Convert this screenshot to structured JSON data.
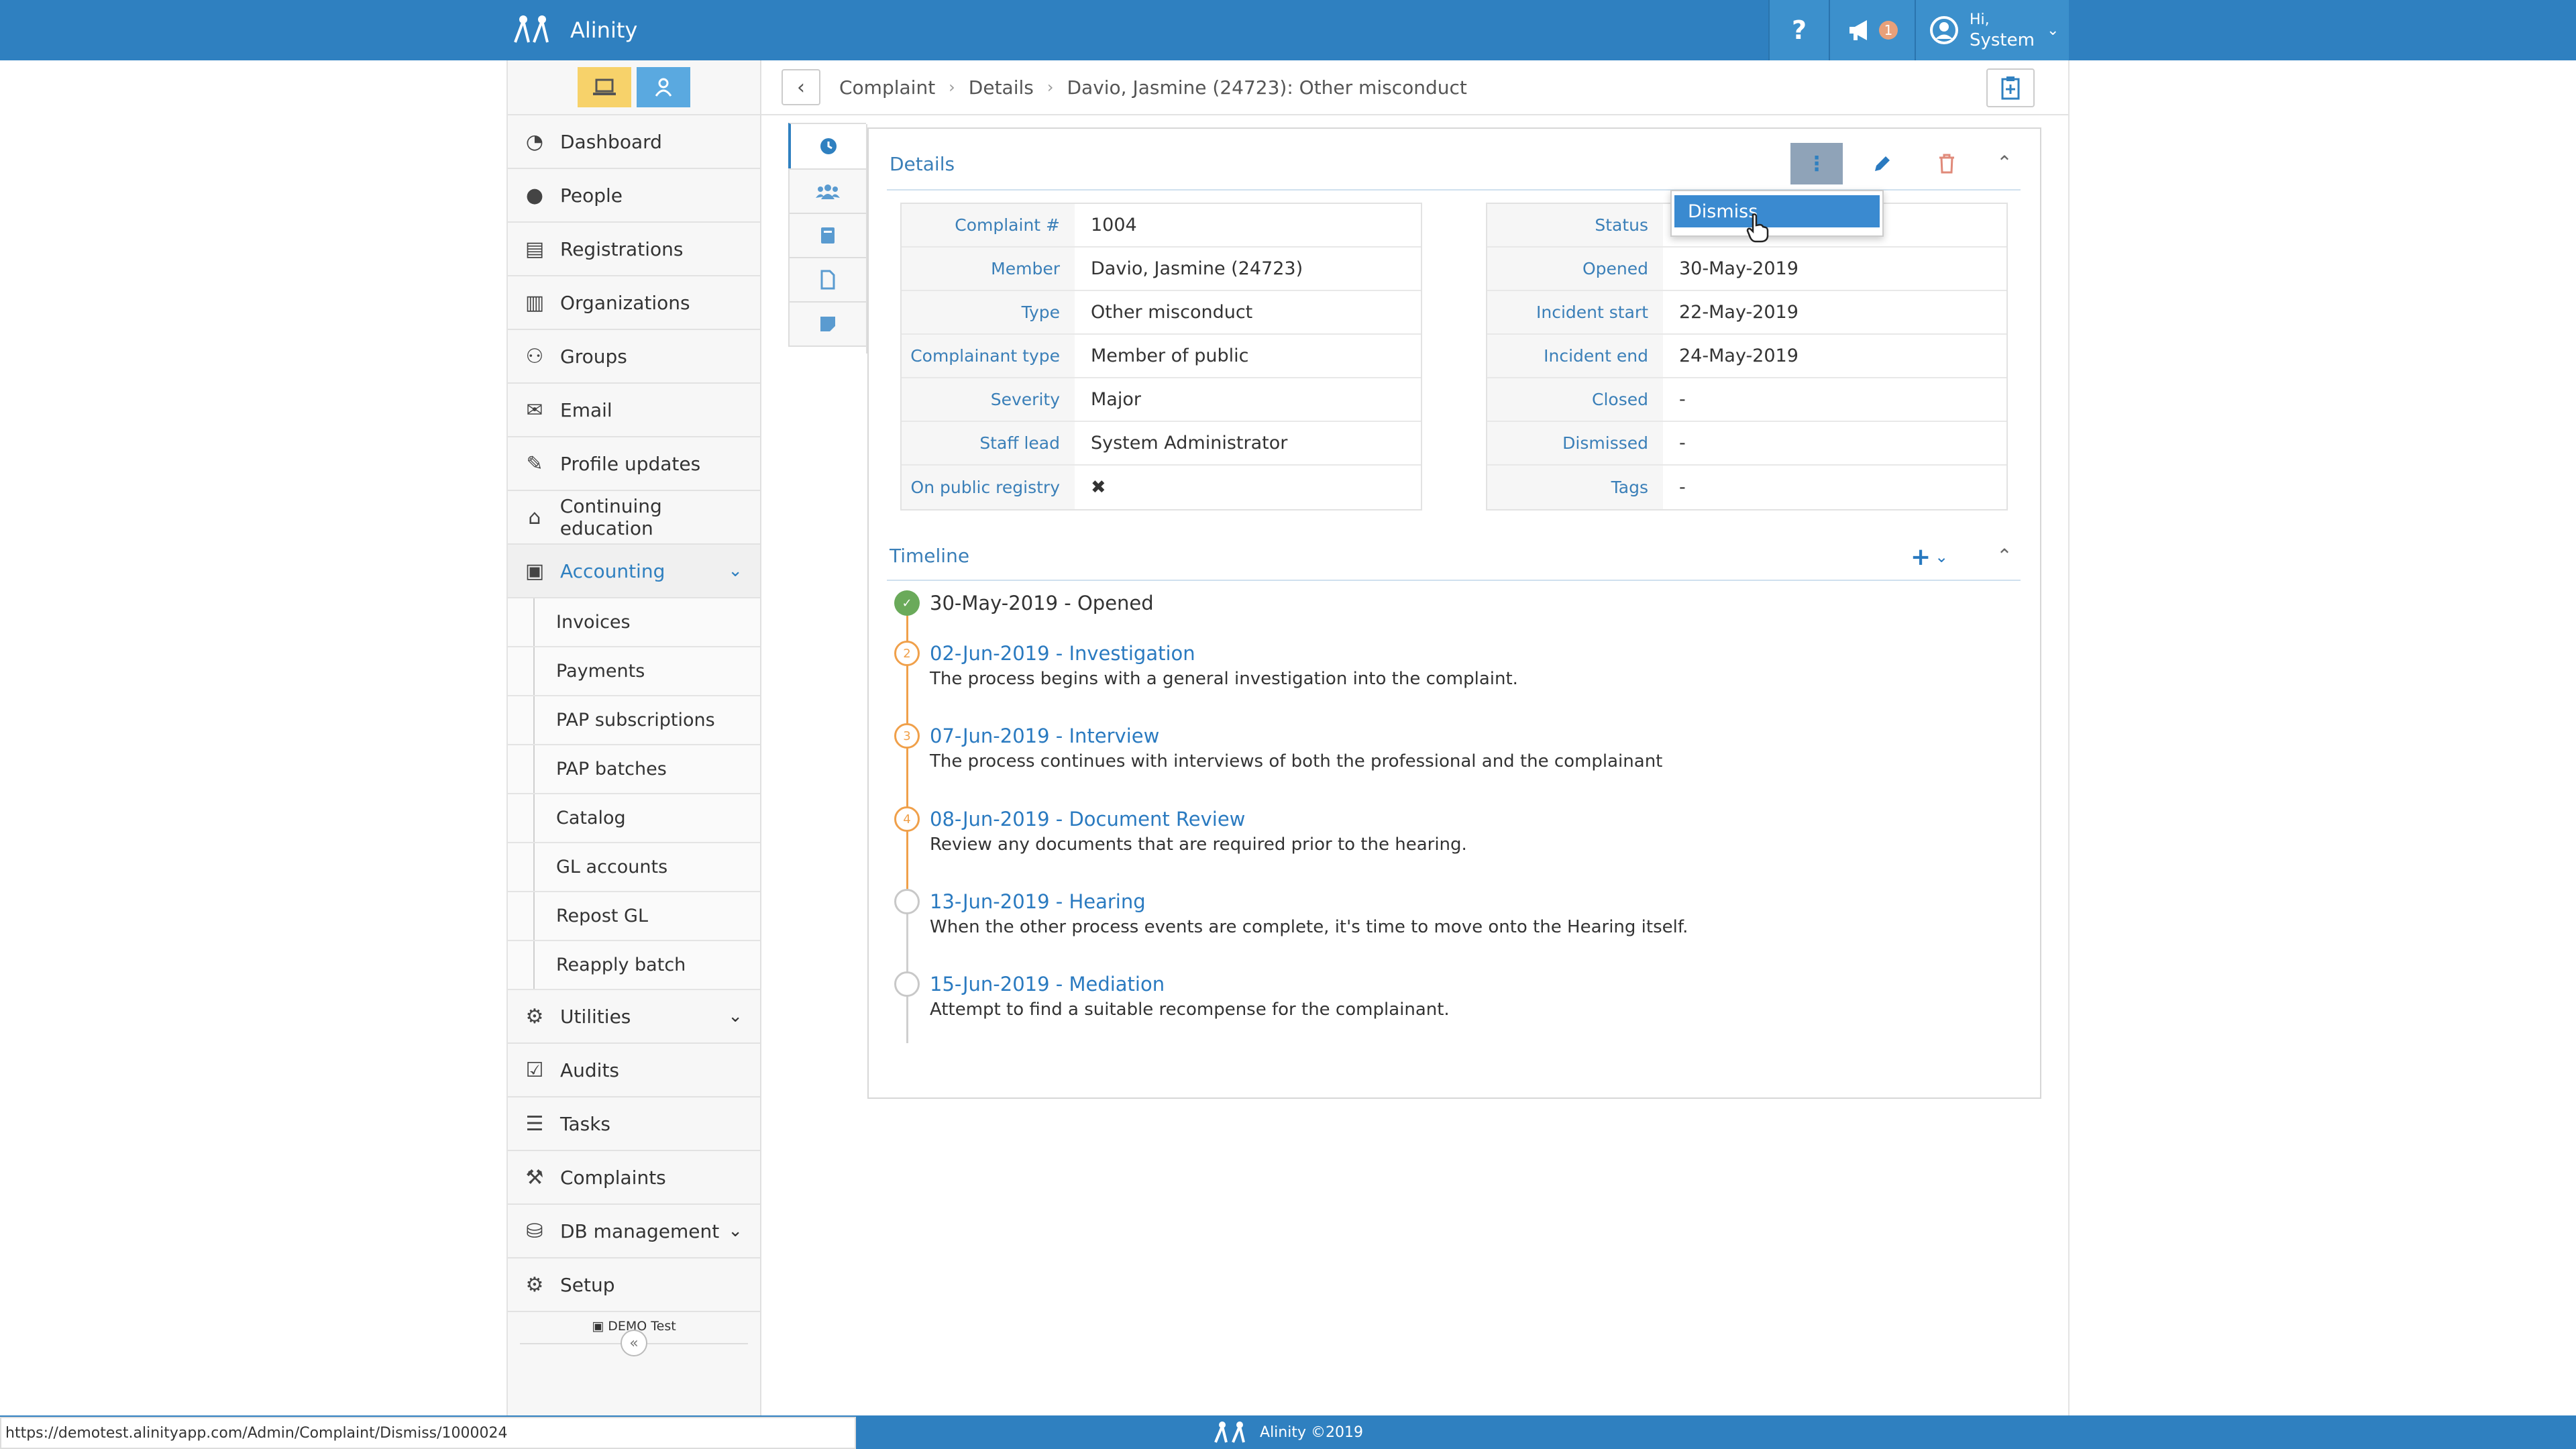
{
  "app": {
    "name": "Alinity",
    "help": "?",
    "notif_count": "1",
    "greeting": "Hi,",
    "user": "System"
  },
  "sidebar": {
    "items": [
      {
        "label": "Dashboard",
        "icon": "dashboard-icon"
      },
      {
        "label": "People",
        "icon": "person-icon"
      },
      {
        "label": "Registrations",
        "icon": "id-card-icon"
      },
      {
        "label": "Organizations",
        "icon": "building-icon"
      },
      {
        "label": "Groups",
        "icon": "users-icon"
      },
      {
        "label": "Email",
        "icon": "envelope-icon"
      },
      {
        "label": "Profile updates",
        "icon": "edit-icon"
      },
      {
        "label": "Continuing education",
        "icon": "graduation-cap-icon"
      },
      {
        "label": "Accounting",
        "icon": "money-icon"
      }
    ],
    "accounting_sub": [
      "Invoices",
      "Payments",
      "PAP subscriptions",
      "PAP batches",
      "Catalog",
      "GL accounts",
      "Repost GL",
      "Reapply batch"
    ],
    "items2": [
      {
        "label": "Utilities",
        "icon": "cogs-icon"
      },
      {
        "label": "Audits",
        "icon": "checkbox-icon"
      },
      {
        "label": "Tasks",
        "icon": "tasks-icon"
      },
      {
        "label": "Complaints",
        "icon": "gavel-icon"
      },
      {
        "label": "DB management",
        "icon": "database-icon"
      },
      {
        "label": "Setup",
        "icon": "gear-icon"
      }
    ],
    "demo": "DEMO Test",
    "collapse": "«"
  },
  "breadcrumb": {
    "c1": "Complaint",
    "c2": "Details",
    "c3": "Davio, Jasmine (24723): Other misconduct"
  },
  "details": {
    "title": "Details",
    "left": [
      {
        "label": "Complaint #",
        "value": "1004"
      },
      {
        "label": "Member",
        "value": "Davio, Jasmine (24723)"
      },
      {
        "label": "Type",
        "value": "Other misconduct"
      },
      {
        "label": "Complainant type",
        "value": "Member of public"
      },
      {
        "label": "Severity",
        "value": "Major"
      },
      {
        "label": "Staff lead",
        "value": "System Administrator"
      },
      {
        "label": "On public registry",
        "value": "✖"
      }
    ],
    "right": [
      {
        "label": "Status",
        "value": ""
      },
      {
        "label": "Opened",
        "value": "30-May-2019"
      },
      {
        "label": "Incident start",
        "value": "22-May-2019"
      },
      {
        "label": "Incident end",
        "value": "24-May-2019"
      },
      {
        "label": "Closed",
        "value": "-"
      },
      {
        "label": "Dismissed",
        "value": "-"
      },
      {
        "label": "Tags",
        "value": "-"
      }
    ]
  },
  "menu": {
    "dismiss": "Dismiss"
  },
  "timeline": {
    "title": "Timeline",
    "events": [
      {
        "marker": "✓",
        "title": "30-May-2019 - Opened",
        "desc": ""
      },
      {
        "marker": "2",
        "title": "02-Jun-2019 - Investigation",
        "desc": "The process begins with a general investigation into the complaint."
      },
      {
        "marker": "3",
        "title": "07-Jun-2019 - Interview",
        "desc": "The process continues with interviews of both the professional and the complainant"
      },
      {
        "marker": "4",
        "title": "08-Jun-2019 - Document Review",
        "desc": "Review any documents that are required prior to the hearing."
      },
      {
        "marker": "",
        "title": "13-Jun-2019 - Hearing",
        "desc": "When the other process events are complete, it's time to move onto the Hearing itself."
      },
      {
        "marker": "",
        "title": "15-Jun-2019 - Mediation",
        "desc": "Attempt to find a suitable recompense for the complainant."
      }
    ]
  },
  "footer": {
    "text": "Alinity ©2019",
    "url": "https://demotest.alinityapp.com/Admin/Complaint/Dismiss/1000024"
  }
}
